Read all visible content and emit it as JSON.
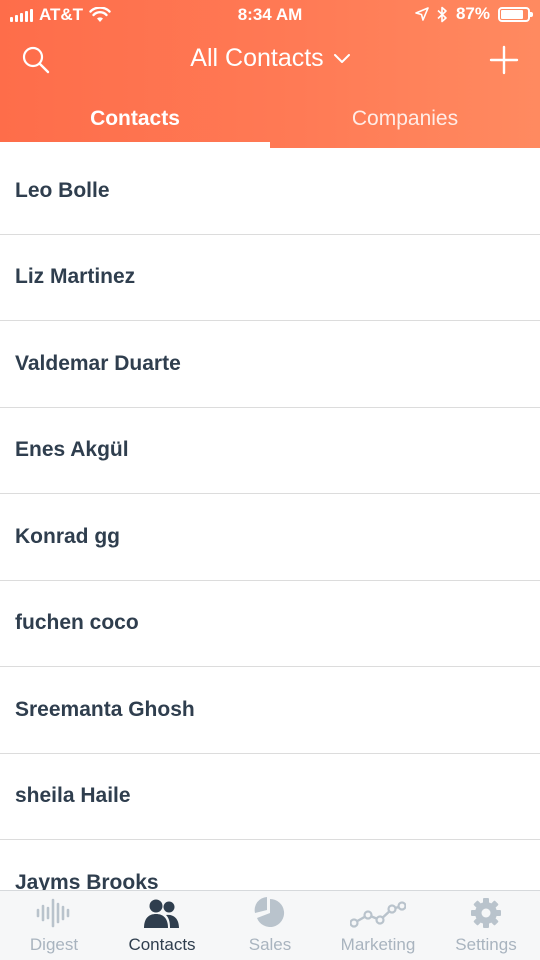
{
  "status_bar": {
    "carrier": "AT&T",
    "time": "8:34 AM",
    "battery_percent": "87%",
    "battery_level": 0.87
  },
  "nav": {
    "title": "All Contacts"
  },
  "tabs": [
    {
      "label": "Contacts",
      "active": true
    },
    {
      "label": "Companies",
      "active": false
    }
  ],
  "contacts": [
    "Leo Bolle",
    "Liz Martinez",
    "Valdemar Duarte",
    "Enes Akgül",
    "Konrad gg",
    "fuchen coco",
    "Sreemanta Ghosh",
    "sheila Haile",
    "Jayms Brooks"
  ],
  "tab_bar": [
    {
      "label": "Digest",
      "icon": "digest-waveform-icon",
      "active": false
    },
    {
      "label": "Contacts",
      "icon": "contacts-people-icon",
      "active": true
    },
    {
      "label": "Sales",
      "icon": "sales-pie-icon",
      "active": false
    },
    {
      "label": "Marketing",
      "icon": "marketing-line-icon",
      "active": false
    },
    {
      "label": "Settings",
      "icon": "settings-gear-icon",
      "active": false
    }
  ],
  "colors": {
    "header_orange": "#ff7a55",
    "text_dark": "#2f3e4e",
    "tab_inactive": "#a9b4bf"
  }
}
